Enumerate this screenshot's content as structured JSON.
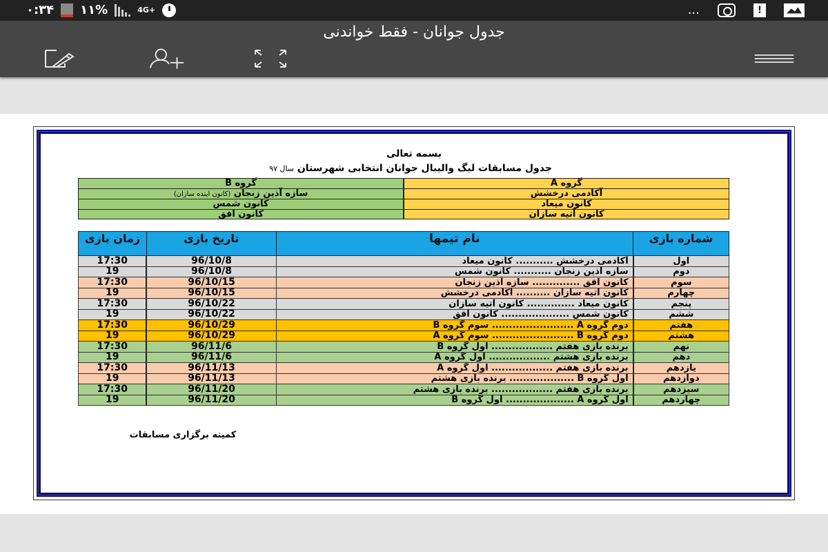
{
  "status_bar": {
    "time": "۰:۳۴",
    "battery_percent": "۱۱%",
    "network": "4G+",
    "overflow": "...",
    "icons": [
      "battery-icon",
      "signal-icon",
      "network-4g-icon",
      "alarm-icon",
      "instagram-icon",
      "clipboard-alert-icon",
      "image-icon"
    ]
  },
  "toolbar": {
    "title": "جدول جوانان - فقط خواندنی",
    "actions": [
      {
        "name": "edit-icon",
        "label": "edit"
      },
      {
        "name": "add-person-icon",
        "label": "share"
      },
      {
        "name": "fullscreen-icon",
        "label": "fullscreen"
      },
      {
        "name": "menu-icon",
        "label": "menu"
      }
    ]
  },
  "document": {
    "basmala": "بسمه تعالی",
    "title": "جدول مسابقات لیگ والیبال جوانان انتخابی شهرستان",
    "year": "سال ۹۷",
    "groups": {
      "a": {
        "header": "گروه A",
        "teams": [
          "آکادمی درخشش",
          "کانون میعاد",
          "کانون آتیه سازان"
        ],
        "color": "#ffd34e"
      },
      "b": {
        "header": "گروه B",
        "teams": [
          "سازه آذین زنجان",
          "کانون شمس",
          "کانون افق"
        ],
        "team1_note": "(کانون اینده سازان)",
        "color": "#9fce7a"
      }
    },
    "schedule": {
      "headers": {
        "number": "شماره بازی",
        "teams": "نام تیمها",
        "date": "تاریخ بازی",
        "time": "زمان بازی"
      },
      "rows": [
        {
          "number": "اول",
          "home": "آکادمی درخشش",
          "sep": "...........",
          "away": "کانون میعاد",
          "date": "96/10/8",
          "time": "17:30",
          "color": "grey"
        },
        {
          "number": "دوم",
          "home": "سازه آذین زنجان",
          "sep": "...........",
          "away": "کانون شمس",
          "date": "96/10/8",
          "time": "19",
          "color": "grey"
        },
        {
          "number": "سوم",
          "home": "کانون افق",
          "sep": "..............",
          "away": "سازه آذین زنجان",
          "date": "96/10/15",
          "time": "17:30",
          "color": "peach"
        },
        {
          "number": "چهارم",
          "home": "کانون آتیه سازان",
          "sep": "..........",
          "away": "آکادمی درخشش",
          "date": "96/10/15",
          "time": "19",
          "color": "peach"
        },
        {
          "number": "پنجم",
          "home": "کانون میعاد",
          "sep": "..............",
          "away": "کانون آتیه سازان",
          "date": "96/10/22",
          "time": "17:30",
          "color": "grey"
        },
        {
          "number": "ششم",
          "home": "کانون شمس",
          "sep": "....................",
          "away": "کانون افق",
          "date": "96/10/22",
          "time": "19",
          "color": "grey"
        },
        {
          "number": "هفتم",
          "home": "دوم گروه A",
          "sep": "........................",
          "away": "سوم گروه B",
          "date": "96/10/29",
          "time": "17:30",
          "color": "orange"
        },
        {
          "number": "هشتم",
          "home": "دوم گروه B",
          "sep": "........................",
          "away": "سوم گروه A",
          "date": "96/10/29",
          "time": "19",
          "color": "orange"
        },
        {
          "number": "نهم",
          "home": "برنده بازی هفتم",
          "sep": "..................",
          "away": "اول گروه B",
          "date": "96/11/6",
          "time": "17:30",
          "color": "green"
        },
        {
          "number": "دهم",
          "home": "برنده بازی هشتم",
          "sep": "..................",
          "away": "اول گروه A",
          "date": "96/11/6",
          "time": "19",
          "color": "green"
        },
        {
          "number": "یازدهم",
          "home": "برنده بازی هفتم",
          "sep": "..................",
          "away": "اول گروه A",
          "date": "96/11/13",
          "time": "17:30",
          "color": "peach"
        },
        {
          "number": "دوازدهم",
          "home": "اول گروه B",
          "sep": "...................",
          "away": "برنده بازی هشتم",
          "date": "96/11/13",
          "time": "19",
          "color": "peach"
        },
        {
          "number": "سیزدهم",
          "home": "برنده بازی هفتم",
          "sep": "..................",
          "away": "برنده بازی هشتم",
          "date": "96/11/20",
          "time": "17:30",
          "color": "green"
        },
        {
          "number": "چهاردهم",
          "home": "اول گروه A",
          "sep": "....................",
          "away": "اول گروه B",
          "date": "96/11/20",
          "time": "19",
          "color": "green"
        }
      ]
    },
    "signature": "کمیته برگزاری مسابقات"
  },
  "colors": {
    "status_bar": "#222222",
    "toolbar": "#464646",
    "page_border": "#0a0a82",
    "header_blue": "#1aa4e4",
    "row_grey": "#d9d9d9",
    "row_peach": "#f8cbad",
    "row_orange": "#ffc000",
    "row_green": "#a9d08e"
  }
}
